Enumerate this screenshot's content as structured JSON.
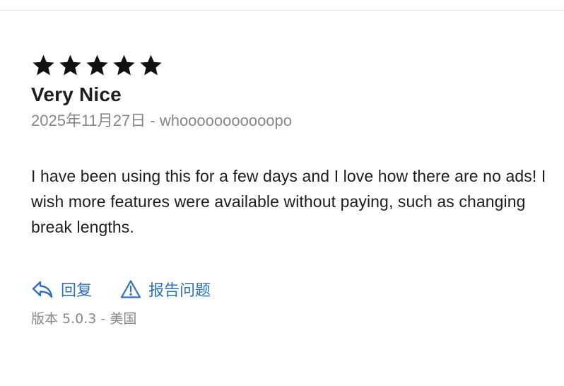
{
  "review": {
    "rating": 5,
    "rating_max": 5,
    "title": "Very Nice",
    "date": "2025年11月27日",
    "separator": " - ",
    "author": "whooooooooooopo",
    "body": "I have been using this for a few days and I love how there are no ads! I wish more features were available without paying, such as changing break lengths."
  },
  "actions": {
    "reply_label": "回复",
    "reply_icon": "reply-arrow-icon",
    "report_label": "报告问题",
    "report_icon": "warning-triangle-icon",
    "accent_color": "#2f6fbd"
  },
  "footer": {
    "version_label": "版本 5.0.3",
    "separator": " - ",
    "region": "美国"
  }
}
